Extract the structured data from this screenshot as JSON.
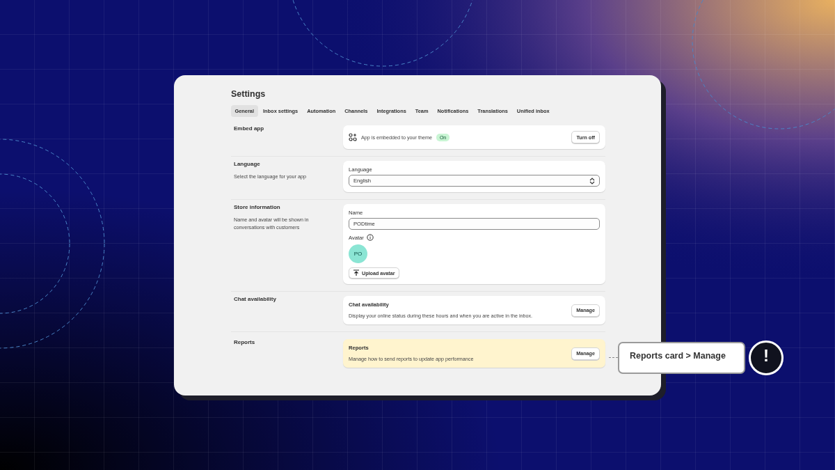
{
  "window": {
    "title": "Settings"
  },
  "tabs": [
    {
      "label": "General",
      "selected": true
    },
    {
      "label": "Inbox settings",
      "selected": false
    },
    {
      "label": "Automation",
      "selected": false
    },
    {
      "label": "Channels",
      "selected": false
    },
    {
      "label": "Integrations",
      "selected": false
    },
    {
      "label": "Team",
      "selected": false
    },
    {
      "label": "Notifications",
      "selected": false
    },
    {
      "label": "Translations",
      "selected": false
    },
    {
      "label": "Unified inbox",
      "selected": false
    }
  ],
  "embed": {
    "heading": "Embed app",
    "status_text": "App is embedded to your theme",
    "badge": "On",
    "on": true,
    "button": "Turn off"
  },
  "language": {
    "heading": "Language",
    "description": "Select the language for your app",
    "field_label": "Language",
    "value": "English"
  },
  "store": {
    "heading": "Store information",
    "description": "Name and avatar will be shown in conversations with customers",
    "name_label": "Name",
    "name_value": "PODtime",
    "avatar_label": "Avatar",
    "avatar_initials": "PO",
    "upload_button": "Upload avatar"
  },
  "chat": {
    "heading": "Chat availability",
    "card_title": "Chat availability",
    "card_text": "Display your online status during these hours and when you are active in the inbox.",
    "button": "Manage"
  },
  "reports": {
    "heading": "Reports",
    "card_title": "Reports",
    "card_text": "Manage how to send reports to update app performance",
    "button": "Manage",
    "highlighted": true
  },
  "callout": {
    "label": "Reports card > Manage",
    "badge": "!"
  }
}
